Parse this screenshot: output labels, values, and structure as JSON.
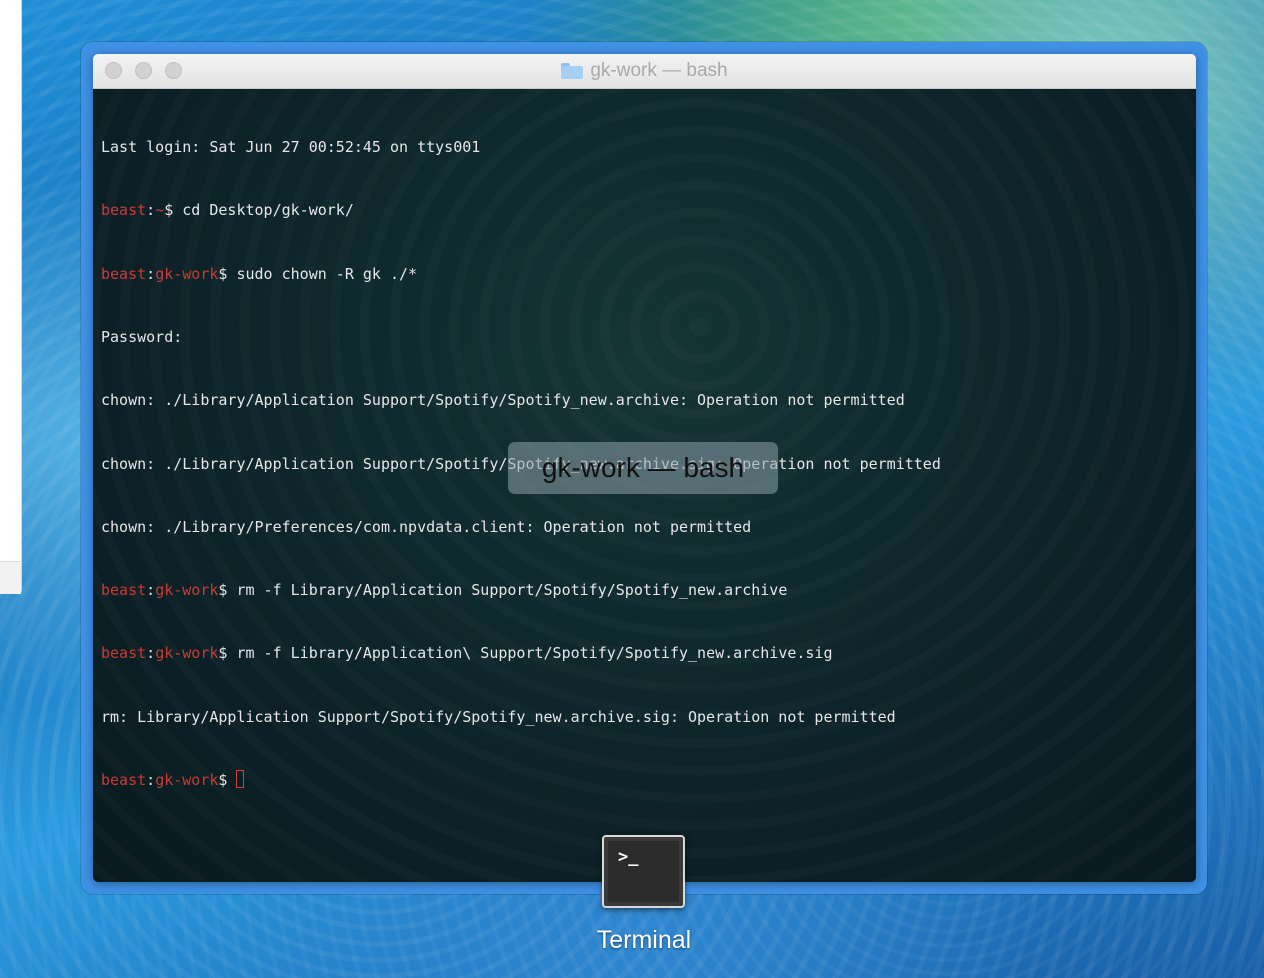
{
  "window": {
    "title": "gk-work — bash"
  },
  "terminal": {
    "line1": "Last login: Sat Jun 27 00:52:45 on ttys001",
    "line2": {
      "host": "beast",
      "path": "~",
      "cmd": " cd Desktop/gk-work/"
    },
    "line3": {
      "host": "beast",
      "path": "gk-work",
      "cmd": " sudo chown -R gk ./*"
    },
    "line4": "Password:",
    "line5": "chown: ./Library/Application Support/Spotify/Spotify_new.archive: Operation not permitted",
    "line6": "chown: ./Library/Application Support/Spotify/Spotify_new.archive.sig: Operation not permitted",
    "line7": "chown: ./Library/Preferences/com.npvdata.client: Operation not permitted",
    "line8": {
      "host": "beast",
      "path": "gk-work",
      "cmd": " rm -f Library/Application Support/Spotify/Spotify_new.archive"
    },
    "line9": {
      "host": "beast",
      "path": "gk-work",
      "cmd": " rm -f Library/Application\\ Support/Spotify/Spotify_new.archive.sig"
    },
    "line10": "rm: Library/Application Support/Spotify/Spotify_new.archive.sig: Operation not permitted",
    "line11": {
      "host": "beast",
      "path": "gk-work",
      "cmd": " "
    }
  },
  "hud": {
    "label": "gk-work — bash"
  },
  "app_switcher": {
    "app_label": "Terminal",
    "icon_text": ">_"
  },
  "colors": {
    "prompt_red": "#cc3a35",
    "highlight_blue": "#3f91e6"
  }
}
